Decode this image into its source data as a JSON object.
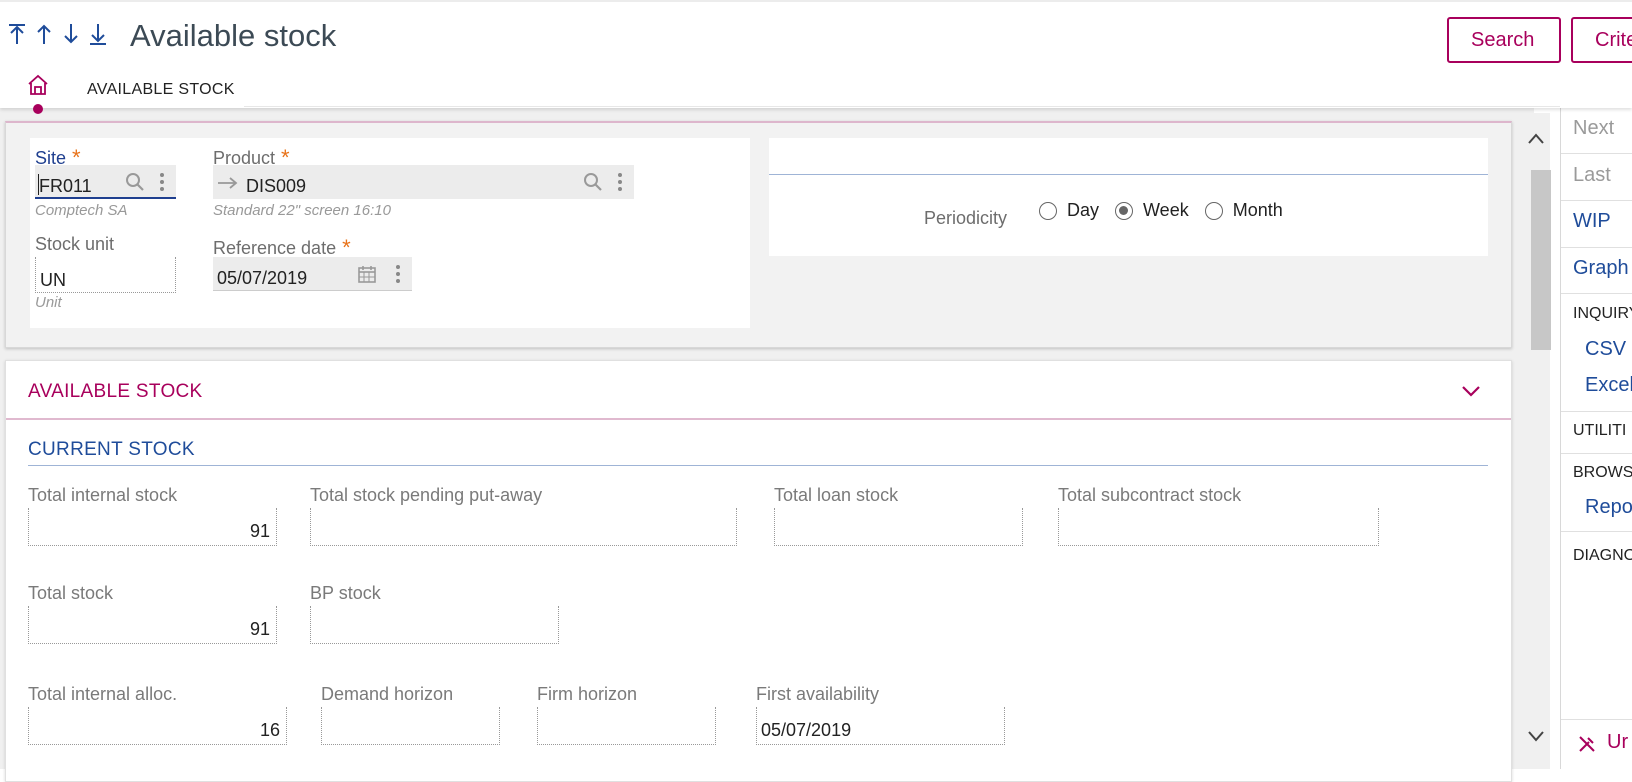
{
  "header": {
    "title": "Available stock",
    "nav": [
      "first-icon",
      "previous-icon",
      "next-icon",
      "last-icon"
    ],
    "buttons": {
      "search": "Search",
      "criteria": "Crite"
    },
    "tab_label": "AVAILABLE STOCK"
  },
  "criteria": {
    "site": {
      "label": "Site",
      "required": "*",
      "value": "FR011",
      "description": "Comptech SA"
    },
    "product": {
      "label": "Product",
      "required": "*",
      "value": "DIS009",
      "description": "Standard 22\" screen 16:10"
    },
    "stock_unit": {
      "label": "Stock unit",
      "value": "UN",
      "description": "Unit"
    },
    "reference_date": {
      "label": "Reference date",
      "required": "*",
      "value": "05/07/2019"
    },
    "periodicity": {
      "label": "Periodicity",
      "options": [
        "Day",
        "Week",
        "Month"
      ],
      "selected": "Week"
    }
  },
  "stock": {
    "section_title": "AVAILABLE STOCK",
    "block_title": "CURRENT STOCK",
    "fields": {
      "total_internal_stock": {
        "label": "Total internal stock",
        "value": "91"
      },
      "total_stock_pending_putaway": {
        "label": "Total stock pending put-away",
        "value": ""
      },
      "total_loan_stock": {
        "label": "Total loan stock",
        "value": ""
      },
      "total_subcontract_stock": {
        "label": "Total subcontract stock",
        "value": ""
      },
      "total_stock": {
        "label": "Total stock",
        "value": "91"
      },
      "bp_stock": {
        "label": "BP stock",
        "value": ""
      },
      "total_internal_alloc": {
        "label": "Total internal alloc.",
        "value": "16"
      },
      "demand_horizon": {
        "label": "Demand horizon",
        "value": ""
      },
      "firm_horizon": {
        "label": "Firm horizon",
        "value": ""
      },
      "first_availability": {
        "label": "First availability",
        "value": "05/07/2019"
      }
    }
  },
  "right_panel": {
    "next": "Next",
    "last": "Last",
    "wip": "WIP",
    "graph": "Graph",
    "inquiry": "INQUIRY",
    "csv": "CSV",
    "excel": "Excel",
    "utilities": "UTILITI",
    "browse": "BROWS",
    "report": "Repo",
    "diagnostics": "DIAGNO",
    "bottom": "Ur"
  },
  "colors": {
    "accent": "#a8005c",
    "link": "#1f4c9a",
    "required": "#e8731a"
  }
}
